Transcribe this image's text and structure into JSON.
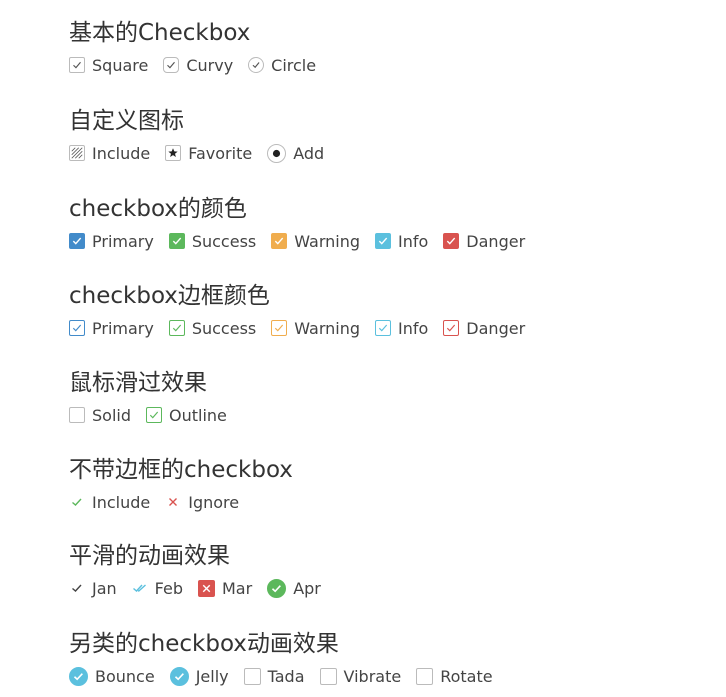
{
  "sections": [
    {
      "title": "基本的Checkbox",
      "items": [
        "Square",
        "Curvy",
        "Circle"
      ]
    },
    {
      "title": "自定义图标",
      "items": [
        "Include",
        "Favorite",
        "Add"
      ]
    },
    {
      "title": "checkbox的颜色",
      "items": [
        "Primary",
        "Success",
        "Warning",
        "Info",
        "Danger"
      ]
    },
    {
      "title": "checkbox边框颜色",
      "items": [
        "Primary",
        "Success",
        "Warning",
        "Info",
        "Danger"
      ]
    },
    {
      "title": "鼠标滑过效果",
      "items": [
        "Solid",
        "Outline"
      ]
    },
    {
      "title": "不带边框的checkbox",
      "items": [
        "Include",
        "Ignore"
      ]
    },
    {
      "title": "平滑的动画效果",
      "items": [
        "Jan",
        "Feb",
        "Mar",
        "Apr"
      ]
    },
    {
      "title": "另类的checkbox动画效果",
      "items": [
        "Bounce",
        "Jelly",
        "Tada",
        "Vibrate",
        "Rotate"
      ]
    }
  ],
  "colors": {
    "primary": "#428bca",
    "success": "#5cb85c",
    "warning": "#f0ad4e",
    "info": "#5bc0de",
    "danger": "#d9534f"
  },
  "icons": {
    "include": "hatch-icon",
    "favorite": "star-icon",
    "add": "dot-icon",
    "ignore": "cross-icon"
  }
}
